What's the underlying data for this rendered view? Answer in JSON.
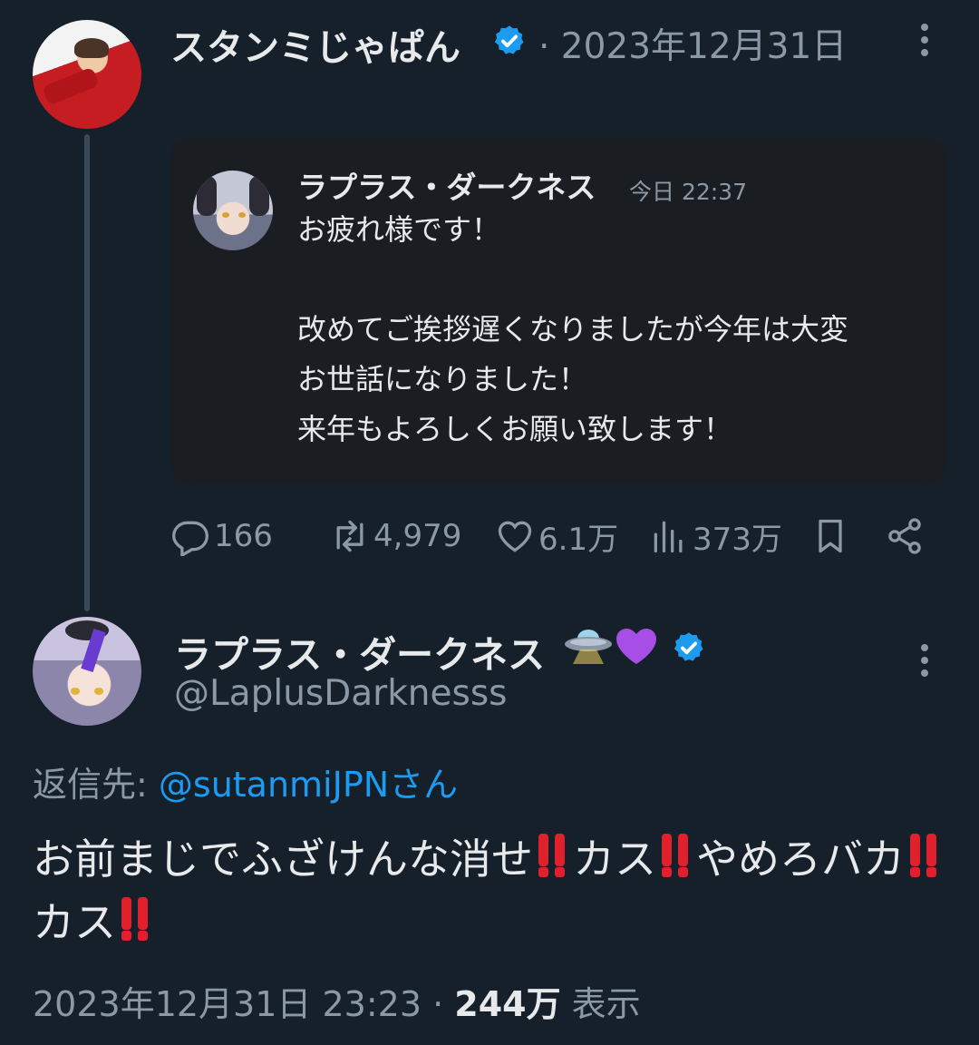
{
  "parent_tweet": {
    "author_name": "スタンミじゃぱん",
    "verified": true,
    "date": "· 2023年12月31日",
    "more_icon": "more-vertical-icon",
    "quoted": {
      "author_name": "ラプラス・ダークネス",
      "time": "今日 22:37",
      "text": "お疲れ様です！\n\n改めてご挨拶遅くなりましたが今年は大変\nお世話になりました！\n来年もよろしくお願い致します！"
    },
    "actions": {
      "replies": "166",
      "retweets": "4,979",
      "likes": "6.1万",
      "views": "373万",
      "reply_icon": "reply-icon",
      "retweet_icon": "retweet-icon",
      "like_icon": "heart-icon",
      "views_icon": "views-chart-icon",
      "bookmark_icon": "bookmark-icon",
      "share_icon": "share-icon"
    }
  },
  "reply_tweet": {
    "author_name": "ラプラス・ダークネス",
    "emoji_icons": [
      "ufo-icon",
      "purple-heart-icon"
    ],
    "verified": true,
    "handle": "@LaplusDarknesss",
    "reply_to_prefix": "返信先: ",
    "reply_to_user": "@sutanmiJPNさん",
    "text_segments": [
      "お前まじでふざけんな消せ",
      "カス",
      "やめろバカ",
      "カス"
    ],
    "emphasis_icon": "double-exclamation-icon",
    "timestamp": "2023年12月31日 23:23 · ",
    "views_count": "244万",
    "views_label": " 表示"
  },
  "colors": {
    "background": "#15202b",
    "text_primary": "#e7e9ea",
    "text_secondary": "#8b98a5",
    "accent": "#1d9bf0",
    "card_bg": "#1a1d22",
    "emphasis_red": "#e0202c"
  }
}
